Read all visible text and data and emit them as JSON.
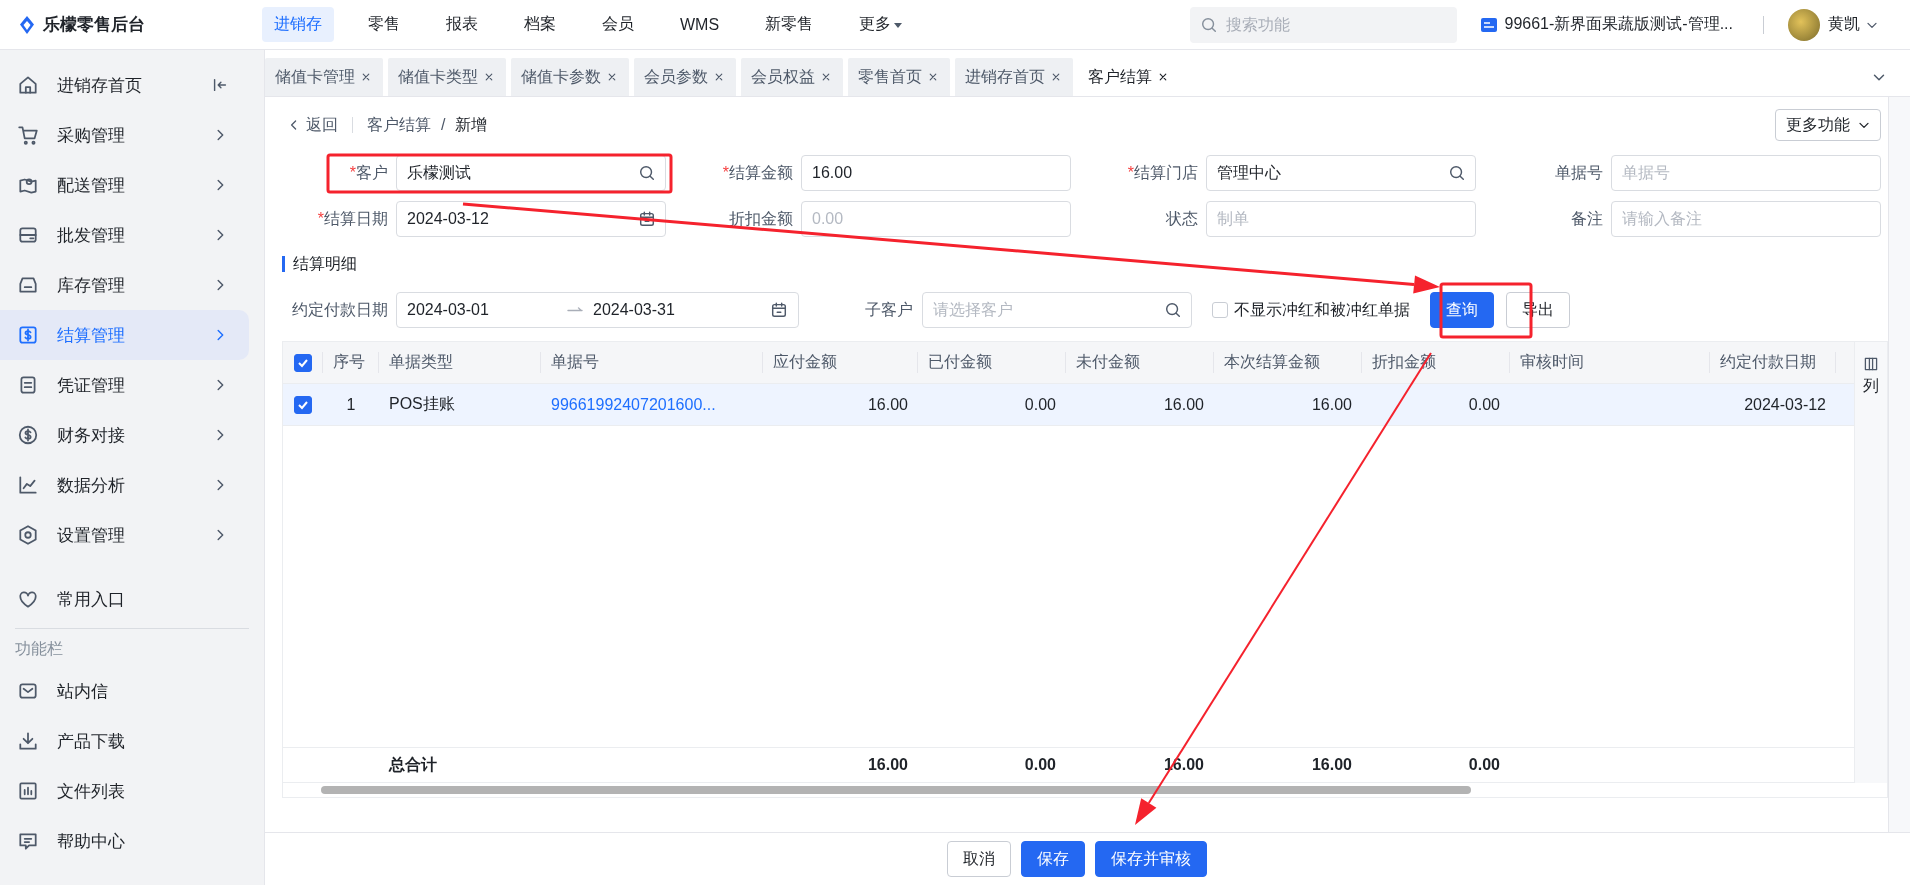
{
  "app": {
    "title": "乐檬零售后台"
  },
  "top_nav": [
    {
      "label": "进销存",
      "selected": true,
      "kind": "link"
    },
    {
      "label": "零售",
      "selected": false,
      "kind": "link"
    },
    {
      "label": "报表",
      "selected": false,
      "kind": "link"
    },
    {
      "label": "档案",
      "selected": false,
      "kind": "link"
    },
    {
      "label": "会员",
      "selected": false,
      "kind": "link"
    },
    {
      "label": "WMS",
      "selected": false,
      "kind": "link"
    },
    {
      "label": "新零售",
      "selected": false,
      "kind": "link"
    },
    {
      "label": "更多",
      "selected": false,
      "kind": "dropdown"
    }
  ],
  "search": {
    "placeholder": "搜索功能"
  },
  "store": {
    "label": "99661-新界面果蔬版测试-管理..."
  },
  "user": {
    "name": "黄凯"
  },
  "sidebar": {
    "items": [
      {
        "label": "进销存首页",
        "kind": "home",
        "selected": false
      },
      {
        "label": "采购管理",
        "kind": "group",
        "selected": false
      },
      {
        "label": "配送管理",
        "kind": "group",
        "selected": false
      },
      {
        "label": "批发管理",
        "kind": "group",
        "selected": false
      },
      {
        "label": "库存管理",
        "kind": "group",
        "selected": false
      },
      {
        "label": "结算管理",
        "kind": "group",
        "selected": true
      },
      {
        "label": "凭证管理",
        "kind": "group",
        "selected": false
      },
      {
        "label": "财务对接",
        "kind": "group",
        "selected": false
      },
      {
        "label": "数据分析",
        "kind": "group",
        "selected": false
      },
      {
        "label": "设置管理",
        "kind": "group",
        "selected": false
      }
    ],
    "favorites": {
      "label": "常用入口"
    },
    "section_title": "功能栏",
    "tools": [
      {
        "label": "站内信"
      },
      {
        "label": "产品下载"
      },
      {
        "label": "文件列表"
      },
      {
        "label": "帮助中心"
      }
    ]
  },
  "tabs": [
    {
      "label": "储值卡管理",
      "selected": false
    },
    {
      "label": "储值卡类型",
      "selected": false
    },
    {
      "label": "储值卡参数",
      "selected": false
    },
    {
      "label": "会员参数",
      "selected": false
    },
    {
      "label": "会员权益",
      "selected": false
    },
    {
      "label": "零售首页",
      "selected": false
    },
    {
      "label": "进销存首页",
      "selected": false
    },
    {
      "label": "客户结算",
      "selected": true
    }
  ],
  "breadcrumb": {
    "back": "返回",
    "items": [
      "客户结算",
      "新增"
    ],
    "separator": "/"
  },
  "more_button": {
    "label": "更多功能"
  },
  "form": {
    "fields": [
      {
        "label": "客户",
        "required_mark": "*",
        "kind": "search",
        "value": "乐檬测试"
      },
      {
        "label": "结算金额",
        "required_mark": "*",
        "kind": "text",
        "value": "16.00"
      },
      {
        "label": "结算门店",
        "required_mark": "*",
        "kind": "search",
        "value": "管理中心"
      },
      {
        "label": "单据号",
        "kind": "text",
        "placeholder": "单据号"
      },
      {
        "label": "结算日期",
        "required_mark": "*",
        "kind": "date",
        "value": "2024-03-12"
      },
      {
        "label": "折扣金额",
        "kind": "text",
        "placeholder": "0.00"
      },
      {
        "label": "状态",
        "kind": "text",
        "placeholder": "制单"
      },
      {
        "label": "备注",
        "kind": "text",
        "placeholder": "请输入备注"
      }
    ]
  },
  "section": {
    "title": "结算明细"
  },
  "filters": {
    "date_range": {
      "label": "约定付款日期",
      "start": "2024-03-01",
      "end": "2024-03-31"
    },
    "sub_customer": {
      "label": "子客户",
      "placeholder": "请选择客户"
    },
    "hide_reversed": {
      "label": "不显示冲红和被冲红单据",
      "checked": false
    },
    "buttons": [
      {
        "label": "查询",
        "kind": "primary"
      },
      {
        "label": "导出",
        "kind": "default"
      }
    ]
  },
  "table": {
    "all_selected": true,
    "columns": [
      "序号",
      "单据类型",
      "单据号",
      "应付金额",
      "已付金额",
      "未付金额",
      "本次结算金额",
      "折扣金额",
      "审核时间",
      "约定付款日期"
    ],
    "rows": [
      {
        "selected": true,
        "cells": [
          "1",
          "POS挂账",
          "99661992407201600...",
          "16.00",
          "0.00",
          "16.00",
          "16.00",
          "0.00",
          null,
          "2024-03-12"
        ]
      }
    ],
    "totals": {
      "label": "总合计",
      "values": [
        "16.00",
        "0.00",
        "16.00",
        "16.00",
        "0.00"
      ]
    },
    "column_settings": {
      "label": "列"
    }
  },
  "actions": [
    {
      "label": "取消",
      "kind": "default"
    },
    {
      "label": "保存",
      "kind": "primary"
    },
    {
      "label": "保存并审核",
      "kind": "primary"
    }
  ]
}
